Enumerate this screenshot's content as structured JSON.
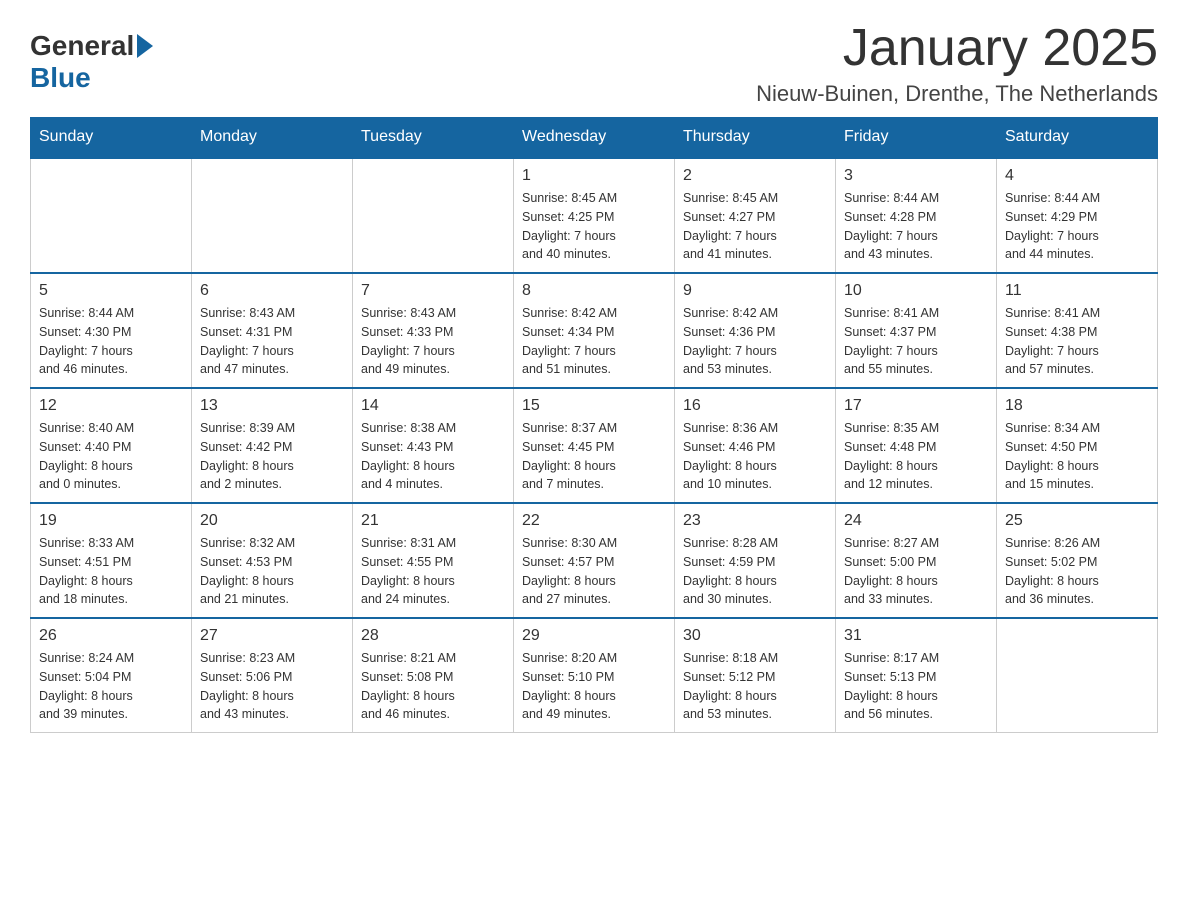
{
  "logo": {
    "general": "General",
    "blue": "Blue",
    "arrow_label": "logo-arrow"
  },
  "title": {
    "month_year": "January 2025",
    "location": "Nieuw-Buinen, Drenthe, The Netherlands"
  },
  "days_of_week": [
    "Sunday",
    "Monday",
    "Tuesday",
    "Wednesday",
    "Thursday",
    "Friday",
    "Saturday"
  ],
  "weeks": [
    [
      {
        "day": "",
        "info": ""
      },
      {
        "day": "",
        "info": ""
      },
      {
        "day": "",
        "info": ""
      },
      {
        "day": "1",
        "info": "Sunrise: 8:45 AM\nSunset: 4:25 PM\nDaylight: 7 hours\nand 40 minutes."
      },
      {
        "day": "2",
        "info": "Sunrise: 8:45 AM\nSunset: 4:27 PM\nDaylight: 7 hours\nand 41 minutes."
      },
      {
        "day": "3",
        "info": "Sunrise: 8:44 AM\nSunset: 4:28 PM\nDaylight: 7 hours\nand 43 minutes."
      },
      {
        "day": "4",
        "info": "Sunrise: 8:44 AM\nSunset: 4:29 PM\nDaylight: 7 hours\nand 44 minutes."
      }
    ],
    [
      {
        "day": "5",
        "info": "Sunrise: 8:44 AM\nSunset: 4:30 PM\nDaylight: 7 hours\nand 46 minutes."
      },
      {
        "day": "6",
        "info": "Sunrise: 8:43 AM\nSunset: 4:31 PM\nDaylight: 7 hours\nand 47 minutes."
      },
      {
        "day": "7",
        "info": "Sunrise: 8:43 AM\nSunset: 4:33 PM\nDaylight: 7 hours\nand 49 minutes."
      },
      {
        "day": "8",
        "info": "Sunrise: 8:42 AM\nSunset: 4:34 PM\nDaylight: 7 hours\nand 51 minutes."
      },
      {
        "day": "9",
        "info": "Sunrise: 8:42 AM\nSunset: 4:36 PM\nDaylight: 7 hours\nand 53 minutes."
      },
      {
        "day": "10",
        "info": "Sunrise: 8:41 AM\nSunset: 4:37 PM\nDaylight: 7 hours\nand 55 minutes."
      },
      {
        "day": "11",
        "info": "Sunrise: 8:41 AM\nSunset: 4:38 PM\nDaylight: 7 hours\nand 57 minutes."
      }
    ],
    [
      {
        "day": "12",
        "info": "Sunrise: 8:40 AM\nSunset: 4:40 PM\nDaylight: 8 hours\nand 0 minutes."
      },
      {
        "day": "13",
        "info": "Sunrise: 8:39 AM\nSunset: 4:42 PM\nDaylight: 8 hours\nand 2 minutes."
      },
      {
        "day": "14",
        "info": "Sunrise: 8:38 AM\nSunset: 4:43 PM\nDaylight: 8 hours\nand 4 minutes."
      },
      {
        "day": "15",
        "info": "Sunrise: 8:37 AM\nSunset: 4:45 PM\nDaylight: 8 hours\nand 7 minutes."
      },
      {
        "day": "16",
        "info": "Sunrise: 8:36 AM\nSunset: 4:46 PM\nDaylight: 8 hours\nand 10 minutes."
      },
      {
        "day": "17",
        "info": "Sunrise: 8:35 AM\nSunset: 4:48 PM\nDaylight: 8 hours\nand 12 minutes."
      },
      {
        "day": "18",
        "info": "Sunrise: 8:34 AM\nSunset: 4:50 PM\nDaylight: 8 hours\nand 15 minutes."
      }
    ],
    [
      {
        "day": "19",
        "info": "Sunrise: 8:33 AM\nSunset: 4:51 PM\nDaylight: 8 hours\nand 18 minutes."
      },
      {
        "day": "20",
        "info": "Sunrise: 8:32 AM\nSunset: 4:53 PM\nDaylight: 8 hours\nand 21 minutes."
      },
      {
        "day": "21",
        "info": "Sunrise: 8:31 AM\nSunset: 4:55 PM\nDaylight: 8 hours\nand 24 minutes."
      },
      {
        "day": "22",
        "info": "Sunrise: 8:30 AM\nSunset: 4:57 PM\nDaylight: 8 hours\nand 27 minutes."
      },
      {
        "day": "23",
        "info": "Sunrise: 8:28 AM\nSunset: 4:59 PM\nDaylight: 8 hours\nand 30 minutes."
      },
      {
        "day": "24",
        "info": "Sunrise: 8:27 AM\nSunset: 5:00 PM\nDaylight: 8 hours\nand 33 minutes."
      },
      {
        "day": "25",
        "info": "Sunrise: 8:26 AM\nSunset: 5:02 PM\nDaylight: 8 hours\nand 36 minutes."
      }
    ],
    [
      {
        "day": "26",
        "info": "Sunrise: 8:24 AM\nSunset: 5:04 PM\nDaylight: 8 hours\nand 39 minutes."
      },
      {
        "day": "27",
        "info": "Sunrise: 8:23 AM\nSunset: 5:06 PM\nDaylight: 8 hours\nand 43 minutes."
      },
      {
        "day": "28",
        "info": "Sunrise: 8:21 AM\nSunset: 5:08 PM\nDaylight: 8 hours\nand 46 minutes."
      },
      {
        "day": "29",
        "info": "Sunrise: 8:20 AM\nSunset: 5:10 PM\nDaylight: 8 hours\nand 49 minutes."
      },
      {
        "day": "30",
        "info": "Sunrise: 8:18 AM\nSunset: 5:12 PM\nDaylight: 8 hours\nand 53 minutes."
      },
      {
        "day": "31",
        "info": "Sunrise: 8:17 AM\nSunset: 5:13 PM\nDaylight: 8 hours\nand 56 minutes."
      },
      {
        "day": "",
        "info": ""
      }
    ]
  ]
}
